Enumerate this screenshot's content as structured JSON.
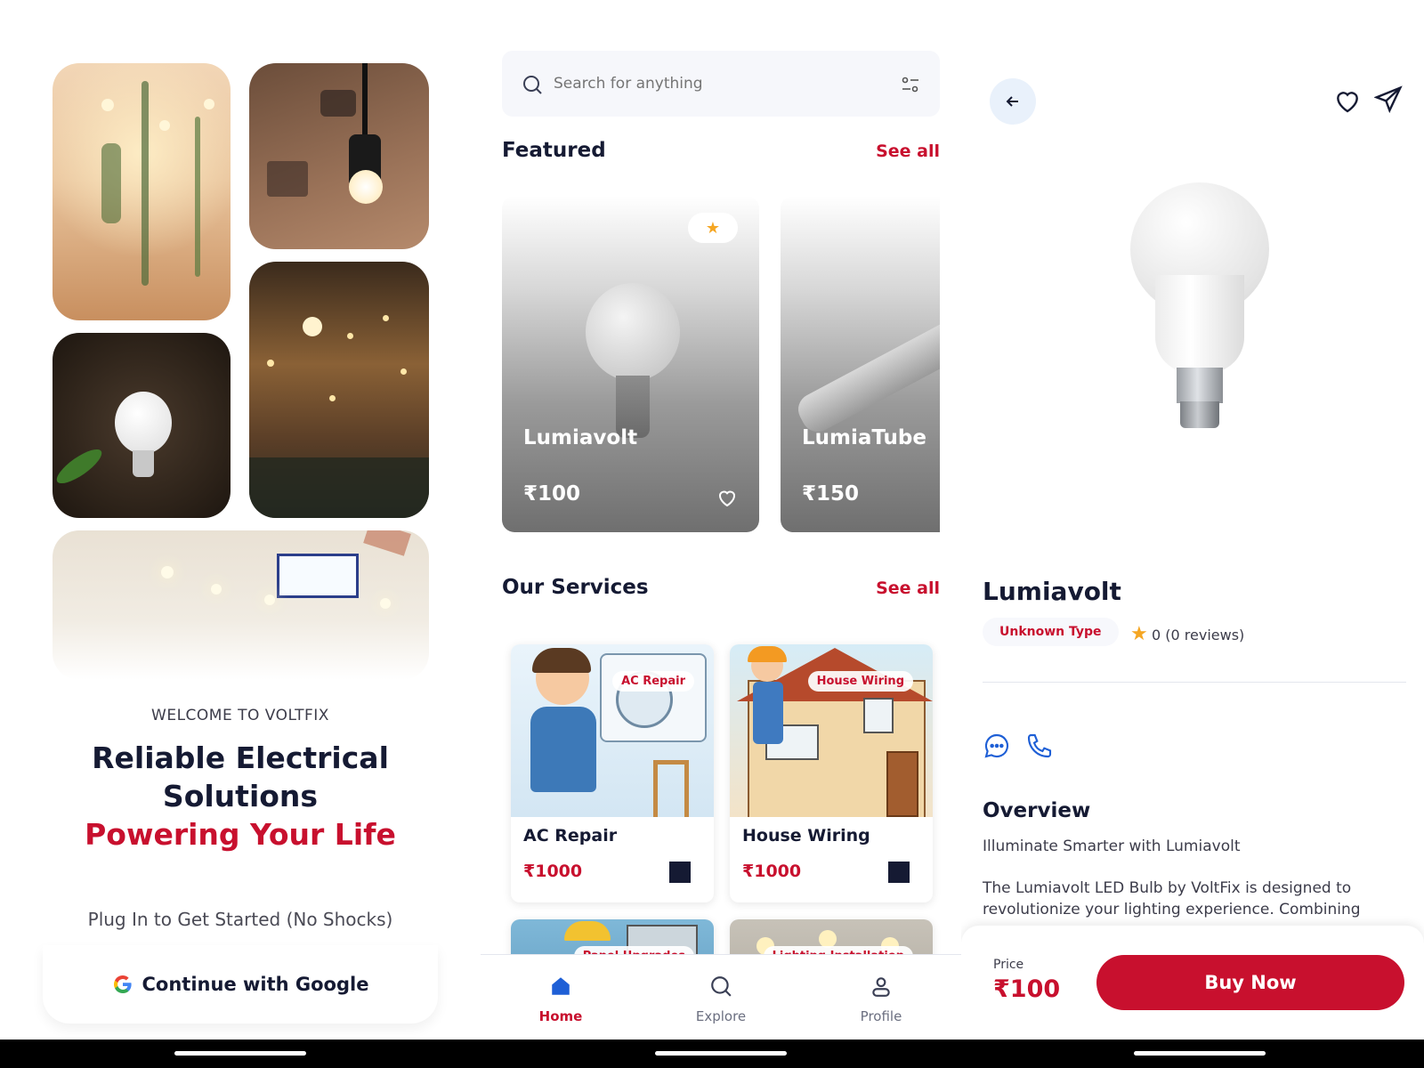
{
  "welcome": {
    "eyebrow": "WELCOME TO VOLTFIX",
    "title_line1": "Reliable Electrical",
    "title_line2": "Solutions",
    "title_line3": "Powering Your Life",
    "subtitle": "Plug In to Get Started (No Shocks)",
    "google_button": "Continue with Google"
  },
  "home": {
    "search": {
      "placeholder": "Search for anything"
    },
    "featured": {
      "title": "Featured",
      "see_all": "See all",
      "items": [
        {
          "name": "Lumiavolt",
          "price": "₹100"
        },
        {
          "name": "LumiaTube",
          "price": "₹150"
        }
      ]
    },
    "services": {
      "title": "Our Services",
      "see_all": "See all",
      "items": [
        {
          "name": "AC Repair",
          "tag": "AC Repair",
          "price": "₹1000"
        },
        {
          "name": "House Wiring",
          "tag": "House Wiring",
          "price": "₹1000"
        },
        {
          "tag": "Panel Upgrades"
        },
        {
          "tag": "Lighting Installation"
        }
      ]
    },
    "nav": [
      {
        "label": "Home",
        "icon": "home-icon",
        "active": true
      },
      {
        "label": "Explore",
        "icon": "search-icon",
        "active": false
      },
      {
        "label": "Profile",
        "icon": "user-icon",
        "active": false
      }
    ]
  },
  "detail": {
    "name": "Lumiavolt",
    "type": "Unknown Type",
    "rating": "0 (0 reviews)",
    "overview_title": "Overview",
    "tagline": "Illuminate Smarter with Lumiavolt",
    "description": "The Lumiavolt LED Bulb by VoltFix is designed to revolutionize your lighting experience. Combining",
    "price_label": "Price",
    "price": "₹100",
    "buy_label": "Buy Now"
  },
  "colors": {
    "accent": "#c8102e",
    "navy": "#151a33",
    "blue": "#1e5fd6"
  }
}
